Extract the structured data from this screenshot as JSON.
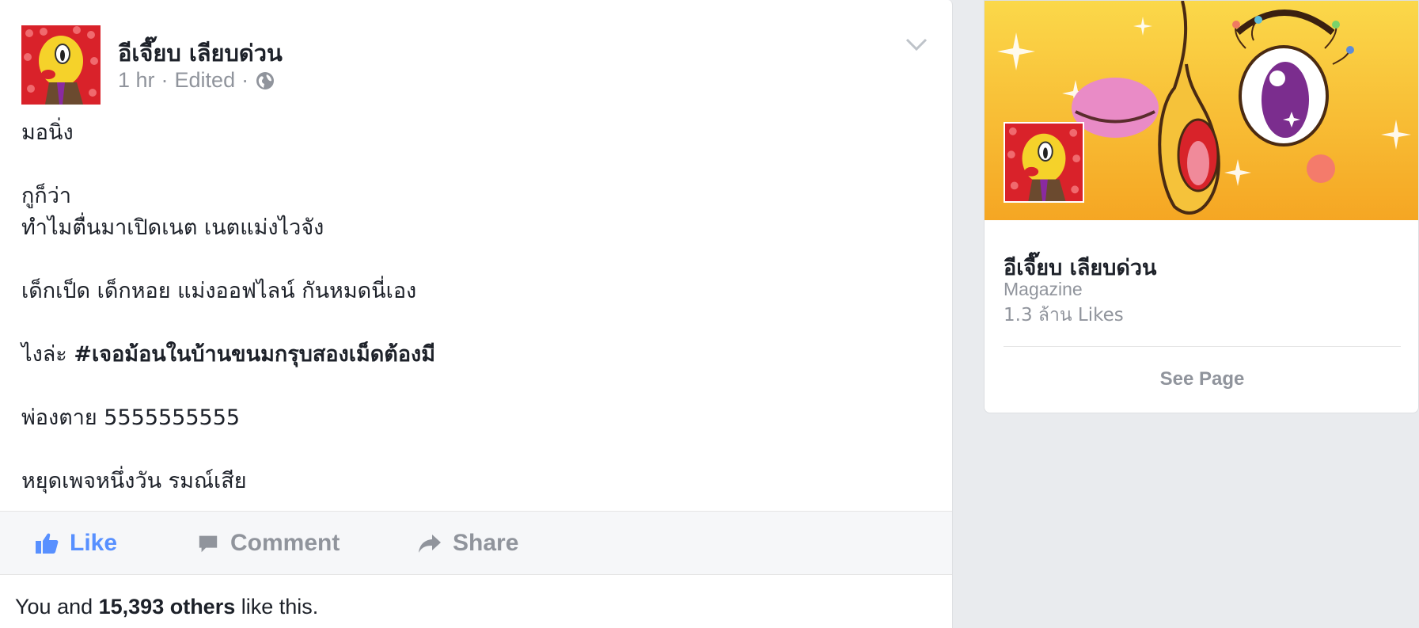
{
  "post": {
    "author": "อีเจี๊ยบ เลียบด่วน",
    "time": "1 hr",
    "edited": "Edited",
    "sep": "·",
    "privacy_icon": "globe-icon",
    "menu_icon": "chevron-down-icon",
    "lines": {
      "l1": "มอนิ่ง",
      "l2": "กูก็ว่า",
      "l3": "ทำไมตื่นมาเปิดเนต เนตแม่งไวจัง",
      "l4": "เด็กเป็ด เด็กหอย แม่งออฟไลน์ กันหมดนี่เอง",
      "l5_prefix": "ไงล่ะ ",
      "l5_hashtag": "#เจอม้อนในบ้านขนมกรุบสองเม็ดต้องมี",
      "l6": "พ่องตาย 5555555555",
      "l7": "หยุดเพจหนึ่งวัน รมณ์เสีย"
    }
  },
  "actions": {
    "like": "Like",
    "comment": "Comment",
    "share": "Share"
  },
  "likes_summary": {
    "prefix": "You and ",
    "count": "15,393 others",
    "suffix": " like this."
  },
  "side_card": {
    "name": "อีเจี๊ยบ เลียบด่วน",
    "category": "Magazine",
    "likes": "1.3 ล้าน Likes",
    "see_page": "See Page"
  },
  "colors": {
    "accent": "#5890ff",
    "muted": "#90949c",
    "text": "#1d2129",
    "cover_yellow": "#f8c33a"
  }
}
